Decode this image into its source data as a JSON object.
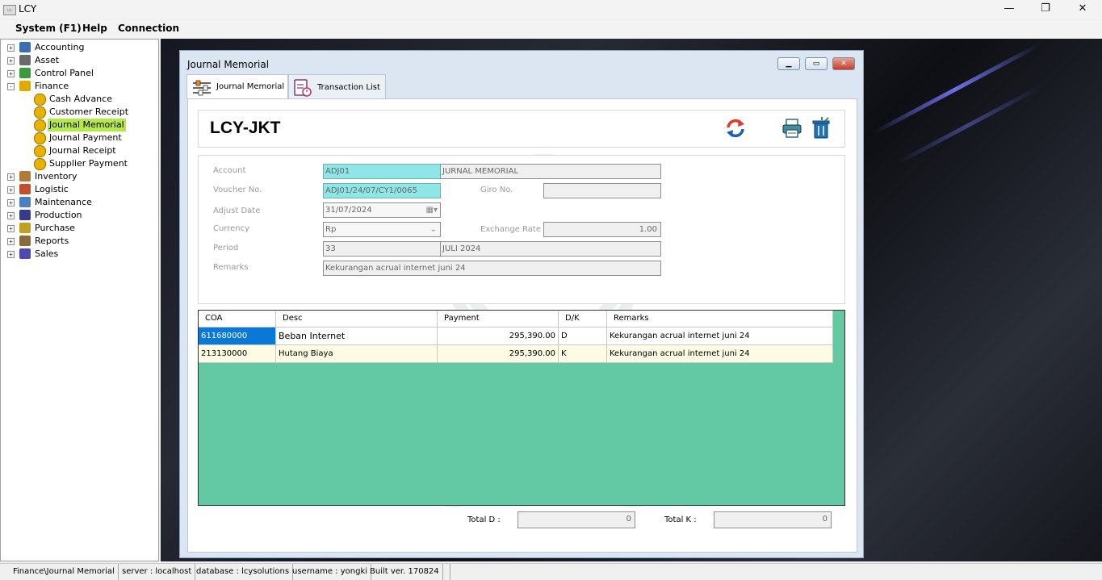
{
  "app": {
    "title": "LCY"
  },
  "menu": {
    "system": "System (F1)",
    "help": "Help",
    "connection": "Connection"
  },
  "tree": [
    {
      "label": "Accounting",
      "expander": "+",
      "icon": "accounting-icon"
    },
    {
      "label": "Asset",
      "expander": "+",
      "icon": "asset-icon"
    },
    {
      "label": "Control Panel",
      "expander": "+",
      "icon": "control-panel-icon"
    },
    {
      "label": "Finance",
      "expander": "-",
      "icon": "finance-icon"
    },
    {
      "label": "Cash Advance",
      "child": true,
      "icon": "cash-advance-icon"
    },
    {
      "label": "Customer Receipt",
      "child": true,
      "icon": "customer-receipt-icon"
    },
    {
      "label": "Journal Memorial",
      "child": true,
      "selected": true,
      "icon": "journal-memorial-icon"
    },
    {
      "label": "Journal Payment",
      "child": true,
      "icon": "journal-payment-icon"
    },
    {
      "label": "Journal Receipt",
      "child": true,
      "icon": "journal-receipt-icon"
    },
    {
      "label": "Supplier Payment",
      "child": true,
      "icon": "supplier-payment-icon"
    },
    {
      "label": "Inventory",
      "expander": "+",
      "icon": "inventory-icon"
    },
    {
      "label": "Logistic",
      "expander": "+",
      "icon": "logistic-icon"
    },
    {
      "label": "Maintenance",
      "expander": "+",
      "icon": "maintenance-icon"
    },
    {
      "label": "Production",
      "expander": "+",
      "icon": "production-icon"
    },
    {
      "label": "Purchase",
      "expander": "+",
      "icon": "purchase-icon"
    },
    {
      "label": "Reports",
      "expander": "+",
      "icon": "reports-icon"
    },
    {
      "label": "Sales",
      "expander": "+",
      "icon": "sales-icon"
    }
  ],
  "window": {
    "title": "Journal Memorial",
    "tabs": [
      "Journal Memorial",
      "Transaction List"
    ],
    "company": "LCY-JKT"
  },
  "form": {
    "account_label": "Account",
    "account_code": "ADJ01",
    "account_name": "JURNAL MEMORIAL",
    "voucher_label": "Voucher No.",
    "voucher_value": "ADJ01/24/07/CY1/0065",
    "giro_label": "Giro No.",
    "giro_value": "",
    "adjust_date_label": "Adjust Date",
    "adjust_date_value": "31/07/2024",
    "currency_label": "Currency",
    "currency_value": "Rp",
    "exchange_label": "Exchange Rate",
    "exchange_value": "1.00",
    "period_label": "Period",
    "period_value": "33",
    "period_name": "JULI 2024",
    "remarks_label": "Remarks",
    "remarks_value": "Kekurangan acrual internet juni 24"
  },
  "grid": {
    "headers": [
      "COA",
      "Desc",
      "Payment",
      "D/K",
      "Remarks"
    ],
    "rows": [
      {
        "coa": "611680000",
        "desc": "Beban Internet",
        "payment": "295,390.00",
        "dk": "D",
        "remarks": "Kekurangan acrual internet juni 24"
      },
      {
        "coa": "213130000",
        "desc": "Hutang Biaya",
        "payment": "295,390.00",
        "dk": "K",
        "remarks": "Kekurangan acrual internet juni 24"
      }
    ]
  },
  "totals": {
    "total_d_label": "Total D :",
    "total_d_value": "0",
    "total_k_label": "Total K :",
    "total_k_value": "0"
  },
  "status": {
    "path": "Finance\\Journal Memorial",
    "server": "server : localhost",
    "database": "database : lcysolutions",
    "username": "username : yongki",
    "build": "Built ver. 170824"
  },
  "colors": {
    "selected_tree": "#b7e84a",
    "grid_bg": "#63c9a4",
    "key_field": "#8fe6e6",
    "selected_cell": "#0a78d7"
  }
}
